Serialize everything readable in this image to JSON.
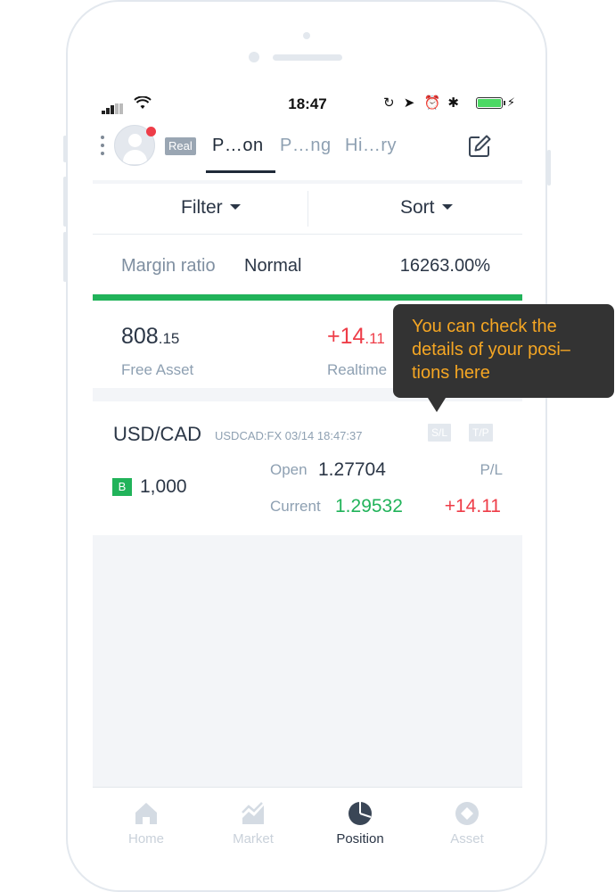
{
  "status_bar": {
    "time": "18:47"
  },
  "header": {
    "account_badge": "Real",
    "tabs": [
      {
        "label": "P…on",
        "active": true
      },
      {
        "label": "P…ng",
        "active": false
      },
      {
        "label": "Hi…ry",
        "active": false
      }
    ]
  },
  "filter_bar": {
    "filter_label": "Filter",
    "sort_label": "Sort"
  },
  "margin": {
    "label": "Margin ratio",
    "status": "Normal",
    "value": "16263.00%",
    "bar_color": "#21b35a"
  },
  "assets": {
    "free_asset_int": "808",
    "free_asset_dec": ".15",
    "free_asset_label": "Free Asset",
    "realtime_int": "+14",
    "realtime_dec": ".11",
    "realtime_label": "Realtime"
  },
  "position": {
    "pair": "USD/CAD",
    "meta": "USDCAD:FX 03/14 18:47:37",
    "sl_tag": "S/L",
    "tp_tag": "T/P",
    "side": "B",
    "quantity": "1,000",
    "open_label": "Open",
    "open_value": "1.27704",
    "current_label": "Current",
    "current_value": "1.29532",
    "pl_label": "P/L",
    "pl_value": "+14.11"
  },
  "tooltip": {
    "line1": "You can check the",
    "line2": "details of your posi–",
    "line3": "tions here"
  },
  "bottom_nav": {
    "items": [
      {
        "label": "Home",
        "icon": "home-icon"
      },
      {
        "label": "Market",
        "icon": "market-icon"
      },
      {
        "label": "Position",
        "icon": "position-icon",
        "active": true
      },
      {
        "label": "Asset",
        "icon": "asset-icon"
      }
    ]
  },
  "colors": {
    "accent_green": "#21b35a",
    "loss_red": "#ee3d48",
    "tooltip_bg": "#333333",
    "tooltip_text": "#f5a623"
  }
}
